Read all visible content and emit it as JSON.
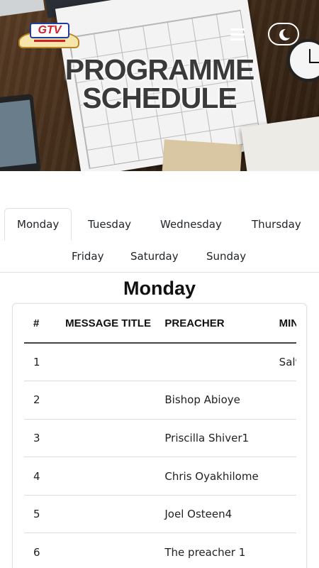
{
  "header": {
    "logo_text": "GTV",
    "title_line1": "PROGRAMME",
    "title_line2": "SCHEDULE",
    "menu_icon": "hamburger-menu-icon",
    "toggle_icon": "night-mode-icon"
  },
  "tabs": [
    {
      "label": "Monday",
      "active": true
    },
    {
      "label": "Tuesday",
      "active": false
    },
    {
      "label": "Wednesday",
      "active": false
    },
    {
      "label": "Thursday",
      "active": false
    },
    {
      "label": "Friday",
      "active": false
    },
    {
      "label": "Saturday",
      "active": false
    },
    {
      "label": "Sunday",
      "active": false
    }
  ],
  "schedule": {
    "day_title": "Monday",
    "columns": [
      "#",
      "MESSAGE TITLE",
      "PREACHER",
      "MINISTRY"
    ],
    "rows": [
      {
        "num": "1",
        "title": "",
        "preacher": "",
        "ministry": "Salvation Ministries"
      },
      {
        "num": "2",
        "title": "",
        "preacher": "Bishop Abioye",
        "ministry": ""
      },
      {
        "num": "3",
        "title": "",
        "preacher": "Priscilla Shiver1",
        "ministry": ""
      },
      {
        "num": "4",
        "title": "",
        "preacher": "Chris Oyakhilome",
        "ministry": ""
      },
      {
        "num": "5",
        "title": "",
        "preacher": "Joel Osteen4",
        "ministry": ""
      },
      {
        "num": "6",
        "title": "",
        "preacher": "The preacher 1",
        "ministry": ""
      }
    ]
  },
  "colors": {
    "tab_border": "#dee2e6",
    "logo_red": "#d0202a",
    "logo_blue": "#1e3fa0"
  }
}
